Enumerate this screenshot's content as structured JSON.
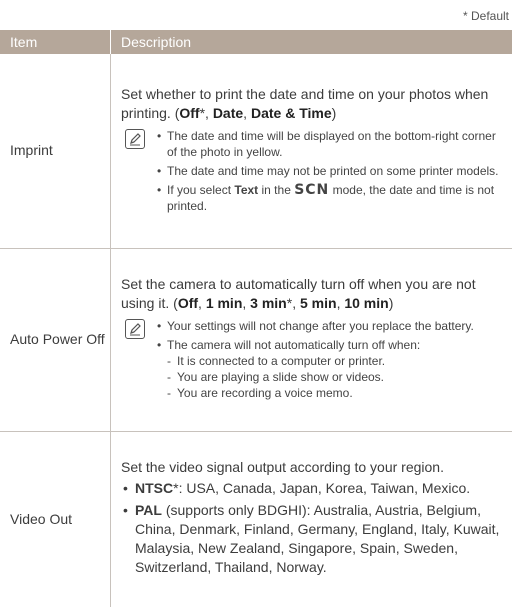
{
  "default_note": "* Default",
  "header": {
    "item": "Item",
    "description": "Description"
  },
  "rows": [
    {
      "item": "Imprint",
      "desc_pre": "Set whether to print the date and time on your photos when printing. (",
      "options": [
        "Off",
        "Date",
        "Date & Time"
      ],
      "notes": [
        "The date and time will be displayed on the bottom-right corner of the photo in yellow.",
        "The date and time may not be printed on some printer models."
      ],
      "note3_pre": "If you select ",
      "note3_bold": "Text",
      "note3_mid": " in the ",
      "note3_mode": "SCN",
      "note3_post": " mode, the date and time is not printed."
    },
    {
      "item": "Auto Power Off",
      "desc_pre": "Set the camera to automatically turn off when you are not using it. (",
      "options": [
        "Off",
        "1 min",
        "3 min",
        "5 min",
        "10 min"
      ],
      "notes": [
        "Your settings will not change after you replace the battery.",
        "The camera will not automatically turn off when:"
      ],
      "subnotes": [
        "It is connected to a computer or printer.",
        "You are playing a slide show or videos.",
        "You are recording a voice memo."
      ]
    },
    {
      "item": "Video Out",
      "desc": "Set the video signal output according to your region.",
      "ntsc_label": "NTSC",
      "ntsc_text": ": USA, Canada, Japan, Korea, Taiwan, Mexico.",
      "pal_label": "PAL",
      "pal_text": " (supports only BDGHI): Australia, Austria, Belgium, China, Denmark, Finland, Germany, England, Italy, Kuwait, Malaysia, New Zealand, Singapore, Spain, Sweden, Switzerland, Thailand, Norway."
    }
  ]
}
